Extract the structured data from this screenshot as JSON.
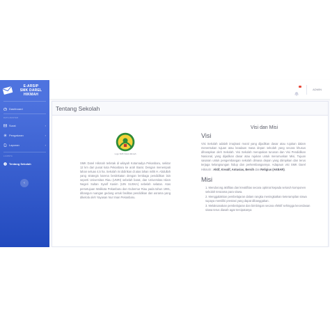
{
  "brand": {
    "line1": "E-ARSIP",
    "line2": "SMK DAREL",
    "line3": "HIKMAH"
  },
  "sidebar": {
    "dashboard": "Dashboard",
    "heading_master": "DATA MASTER",
    "items": [
      {
        "label": "Surat",
        "icon": "envelope-icon"
      },
      {
        "label": "Pengaturan",
        "icon": "gear-icon"
      },
      {
        "label": "Laporan",
        "icon": "file-icon"
      }
    ],
    "heading_lainnya": "LAINNYA",
    "tentang": "Tentang Sekolah",
    "toggle_glyph": "‹"
  },
  "topbar": {
    "user": "ADMIN"
  },
  "page": {
    "title": "Tentang Sekolah",
    "logo_caption": "Logo SMK Darel Hikmah",
    "description": "SMK Darel Hikmah terletak di wilayah Kotamadya Pekanbaru, sekitar 12 km dari pusat kota Pekanbaru ke arah Barat. Dengan menempati lahan seluas 4,5 ha. Sekolah ini didirikan di atas lahan milik H. Abdullah yang strategis karena berdekatan dengan lembaga pendidikan lain seperti Universitas Riau (UNRI) sebelah barat, dan Universitas Islam Negeri Sultan Syarif Kasim (UIN SUSKA) sebelah selatan. Atas persetujuan Walikota Pekanbaru dan Gubernur Riau pada tahun 1991, dibangun ruangan gedung untuk fasilitas pendidikan dan asrama yang dikelola oleh Yayasan Nur Iman Pekanbaru.",
    "section_title": "Visi dan Misi",
    "visi_heading": "Visi",
    "visi_text": "Visi Sekolah adalah imajinasi moral yang dijadikan dasar atau rujukan dalam menentukan tujuan atau keadaan masa depan sekolah yang secara khusus diharapkan oleh Sekolah. Visi Sekolah merupakan turunan dan Visi Pendidikan Nasional, yang dijadikan dasar atau rujukan untuk merumuskan Misi, Tujuan sasaran untuk pengembangan sekolah dimasa depan yang diimpikan dan terus terjaga kelangsungan hidup dan perkembangannya. Adapaun visi SMK Darel Hikmah : ",
    "visi_bold": "Aktif, Kreatif, Antusias, Bersih",
    "visi_and": " dan ",
    "visi_bold2": "Religius (AKBAR)",
    "visi_end": ".",
    "misi_heading": "Misi",
    "misi": [
      "1. Mendorong aktifitas dan kreatifitas secara optimal kepada seluruh komponen sekolah terutama para siswa.",
      "2. Menggalakkan pembelajaran dalam rangka meningkatkan keterampilan siswa supaya memiliki prestasi yang dapat dibanggakan.",
      "3. Melaksanakan pembelajaran dan bimbingan secara efektif sehingga kecerdasan siswa terus diasah agar tercipatanya"
    ]
  },
  "colors": {
    "sidebar_top": "#4e73df",
    "sidebar_bottom": "#224abe",
    "badge": "#e74a3b"
  }
}
